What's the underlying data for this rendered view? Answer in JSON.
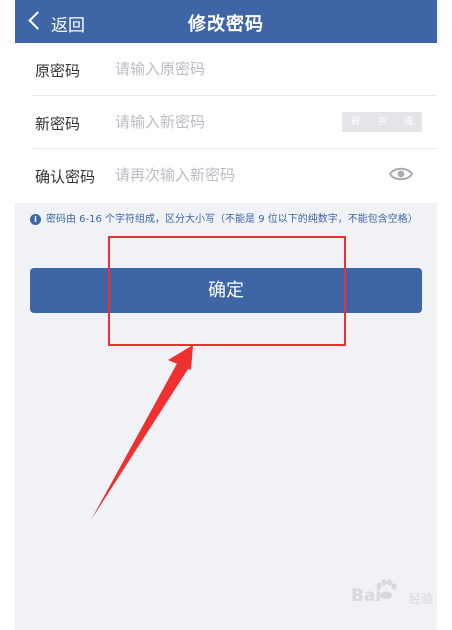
{
  "nav": {
    "back_label": "返回",
    "title": "修改密码",
    "background": "#3e66a6"
  },
  "form": {
    "rows": [
      {
        "label": "原密码",
        "placeholder": "请输入原密码",
        "value": ""
      },
      {
        "label": "新密码",
        "placeholder": "请输入新密码",
        "value": ""
      },
      {
        "label": "确认密码",
        "placeholder": "请再次输入新密码",
        "value": ""
      }
    ],
    "strength_meter": {
      "levels": [
        "弱",
        "中",
        "强"
      ],
      "selected": null
    },
    "eye_icon": "eye-icon"
  },
  "hint": {
    "icon": "info-icon",
    "text": "密码由 6-16 个字符组成，区分大小写（不能是 9 位以下的纯数字，不能包含空格）"
  },
  "confirm_button": {
    "label": "确定"
  },
  "annotation": {
    "color": "#ee3030"
  },
  "watermark": {
    "brand": "Bai",
    "sub": "经验"
  }
}
